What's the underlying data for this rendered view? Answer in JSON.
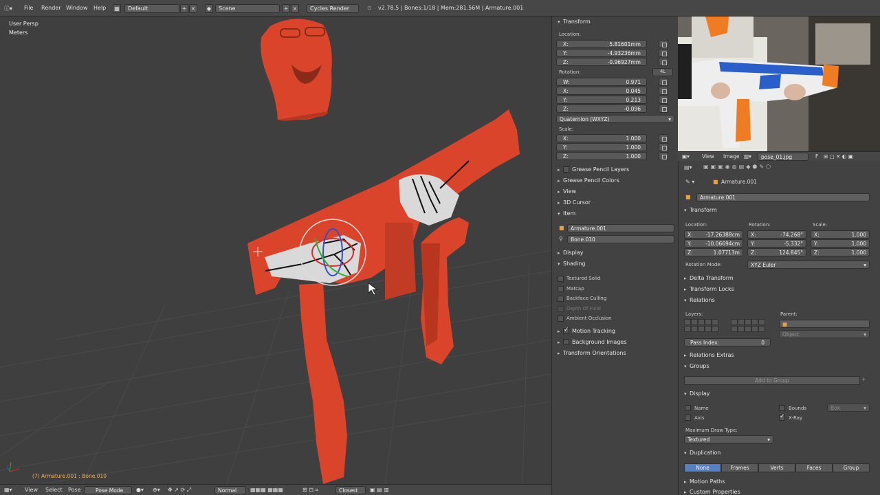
{
  "topbar": {
    "menus": [
      "File",
      "Render",
      "Window",
      "Help"
    ],
    "layout": "Default",
    "scene": "Scene",
    "engine": "Cycles Render",
    "stats": "v2.78.5 | Bones:1/18 | Mem:281.56M | Armature.001"
  },
  "viewport": {
    "view_name": "User Persp",
    "units": "Meters",
    "active_label": "(7) Armature.001 : Bone.010"
  },
  "viewport_header": {
    "menus": [
      "View",
      "Select",
      "Pose"
    ],
    "mode": "Pose Mode",
    "orientation": "Normal",
    "snap": "Closest"
  },
  "npanel": {
    "transform_title": "Transform",
    "location_label": "Location:",
    "location": [
      {
        "axis": "X:",
        "value": "5.81601mm"
      },
      {
        "axis": "Y:",
        "value": "-4.93236mm"
      },
      {
        "axis": "Z:",
        "value": "-0.96927mm"
      }
    ],
    "rotation_label": "Rotation:",
    "rotation_4l": "4L",
    "rotation": [
      {
        "axis": "W:",
        "value": "0.971"
      },
      {
        "axis": "X:",
        "value": "0.045"
      },
      {
        "axis": "Y:",
        "value": "0.213"
      },
      {
        "axis": "Z:",
        "value": "-0.096"
      }
    ],
    "rotation_mode": "Quaternion (WXYZ)",
    "scale_label": "Scale:",
    "scale": [
      {
        "axis": "X:",
        "value": "1.000"
      },
      {
        "axis": "Y:",
        "value": "1.000"
      },
      {
        "axis": "Z:",
        "value": "1.000"
      }
    ],
    "panels": [
      "Grease Pencil Layers",
      "Grease Pencil Colors",
      "View",
      "3D Cursor",
      "Item"
    ],
    "item_object": "Armature.001",
    "item_bone": "Bone.010",
    "display_title": "Display",
    "shading_title": "Shading",
    "shading_options": [
      {
        "label": "Textured Solid",
        "checked": false
      },
      {
        "label": "Matcap",
        "checked": false
      },
      {
        "label": "Backface Culling",
        "checked": false
      },
      {
        "label": "Depth Of Field",
        "checked": false
      },
      {
        "label": "Ambient Occlusion",
        "checked": false
      }
    ],
    "motion_tracking": "Motion Tracking",
    "background_images": "Background Images",
    "transform_orientations": "Transform Orientations"
  },
  "image_editor": {
    "menus": [
      "View",
      "Image"
    ],
    "image_name": "pose_01.jpg",
    "fake_user": "F"
  },
  "properties": {
    "breadcrumb": "Armature.001",
    "object_name": "Armature.001",
    "transform_title": "Transform",
    "location_label": "Location:",
    "rotation_label": "Rotation:",
    "scale_label": "Scale:",
    "location": [
      {
        "axis": "X:",
        "value": "-17.26388cm"
      },
      {
        "axis": "Y:",
        "value": "-10.06694cm"
      },
      {
        "axis": "Z:",
        "value": "1.07713m"
      }
    ],
    "rotation": [
      {
        "axis": "X:",
        "value": "-74.268°"
      },
      {
        "axis": "Y:",
        "value": "-5.332°"
      },
      {
        "axis": "Z:",
        "value": "124.845°"
      }
    ],
    "scale": [
      {
        "axis": "X:",
        "value": "1.000"
      },
      {
        "axis": "Y:",
        "value": "1.000"
      },
      {
        "axis": "Z:",
        "value": "1.000"
      }
    ],
    "rotation_mode_label": "Rotation Mode:",
    "rotation_mode": "XYZ Euler",
    "delta_transform": "Delta Transform",
    "transform_locks": "Transform Locks",
    "relations": "Relations",
    "layers_label": "Layers:",
    "parent_label": "Parent:",
    "parent_type": "Object",
    "pass_index_label": "Pass Index:",
    "pass_index": "0",
    "relations_extras": "Relations Extras",
    "groups": "Groups",
    "add_to_group": "Add to Group",
    "display": "Display",
    "display_name": "Name",
    "display_axis": "Axis",
    "display_bounds": "Bounds",
    "bounds_type": "Box",
    "display_xray": "X-Ray",
    "max_draw_type_label": "Maximum Draw Type:",
    "max_draw_type": "Textured",
    "duplication": "Duplication",
    "dup_options": [
      "None",
      "Frames",
      "Verts",
      "Faces",
      "Group"
    ],
    "motion_paths": "Motion Paths",
    "custom_properties": "Custom Properties"
  },
  "colors": {
    "model": "#d9442b",
    "hand": "#d6d6d6",
    "selection": "#5680c2"
  }
}
